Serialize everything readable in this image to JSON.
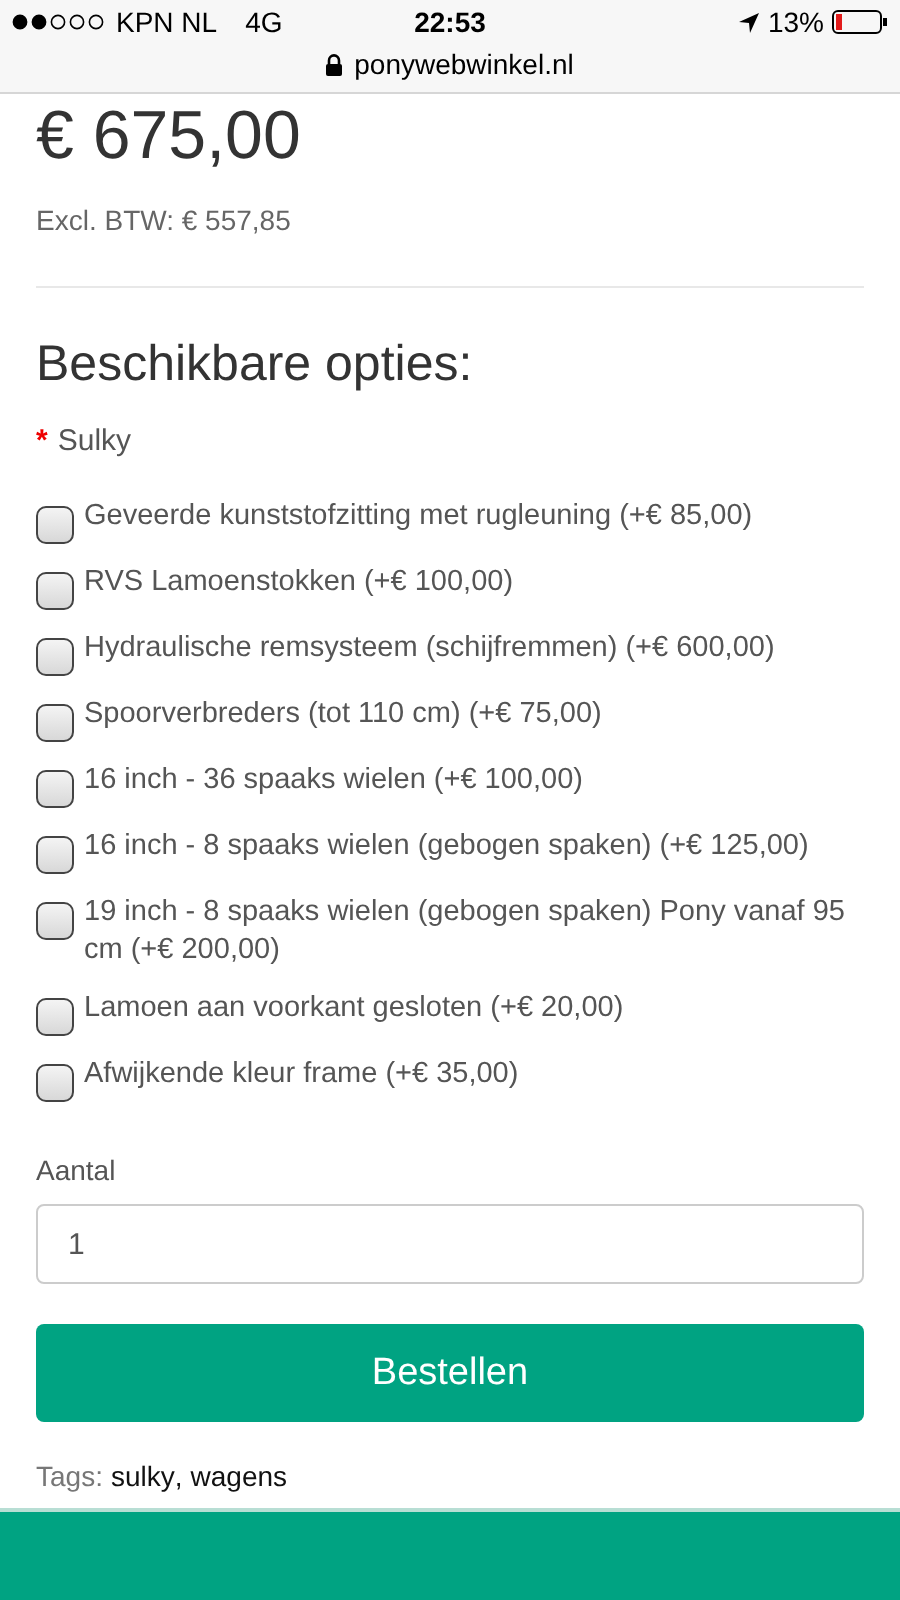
{
  "status_bar": {
    "carrier": "KPN NL",
    "network": "4G",
    "time": "22:53",
    "battery": "13%"
  },
  "address_bar": {
    "url": "ponywebwinkel.nl"
  },
  "price": "€ 675,00",
  "price_excl": "Excl. BTW: € 557,85",
  "options": {
    "title": "Beschikbare opties:",
    "required_mark": "*",
    "group": "Sulky",
    "items": [
      {
        "label": "Geveerde kunststofzitting met rugleuning (+€ 85,00)",
        "checked": false
      },
      {
        "label": "RVS Lamoenstokken (+€ 100,00)",
        "checked": false
      },
      {
        "label": "Hydraulische remsysteem (schijfremmen) (+€ 600,00)",
        "checked": false
      },
      {
        "label": "Spoorverbreders (tot 110 cm) (+€ 75,00)",
        "checked": false
      },
      {
        "label": "16 inch - 36 spaaks wielen (+€ 100,00)",
        "checked": false
      },
      {
        "label": "16 inch - 8 spaaks wielen (gebogen spaken) (+€ 125,00)",
        "checked": false
      },
      {
        "label": "19 inch - 8 spaaks wielen (gebogen spaken) Pony vanaf 95 cm (+€ 200,00)",
        "checked": false
      },
      {
        "label": "Lamoen aan voorkant gesloten (+€ 20,00)",
        "checked": false
      },
      {
        "label": "Afwijkende kleur frame (+€ 35,00)",
        "checked": false
      }
    ]
  },
  "quantity": {
    "label": "Aantal",
    "value": "1"
  },
  "order_button": "Bestellen",
  "tags": {
    "label": "Tags:",
    "separator": ",",
    "items": [
      "sulky",
      "wagens"
    ]
  }
}
